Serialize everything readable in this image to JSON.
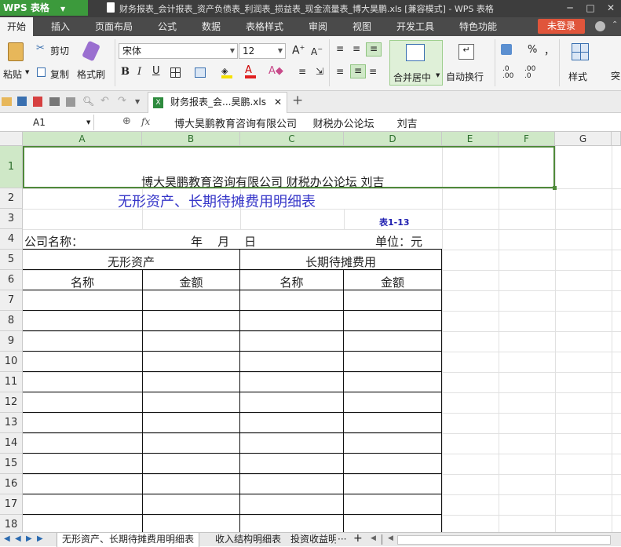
{
  "app": {
    "badge": "WPS 表格",
    "window_title": "财务报表_会计报表_资产负债表_利润表_损益表_现金流量表_博大昊鹏.xls [兼容模式] - WPS 表格"
  },
  "menu": {
    "tabs": [
      "开始",
      "插入",
      "页面布局",
      "公式",
      "数据",
      "表格样式",
      "审阅",
      "视图",
      "开发工具",
      "特色功能"
    ],
    "login": "未登录"
  },
  "ribbon": {
    "paste": "粘贴",
    "cut": "剪切",
    "copy": "复制",
    "format_painter": "格式刷",
    "font_name": "宋体",
    "font_size": "12",
    "merge_center": "合并居中",
    "wrap_text": "自动换行",
    "styles": "样式",
    "percent": "%",
    "comma": "，",
    "more": "突"
  },
  "quickbar": {
    "doc_tab": "财务报表_会...昊鹏.xls"
  },
  "formula": {
    "name_box": "A1",
    "fx": "fx",
    "content": "博大昊鹏教育咨询有限公司     财税办公论坛       刘吉"
  },
  "grid": {
    "columns": [
      "A",
      "B",
      "C",
      "D",
      "E",
      "F",
      "G"
    ],
    "rows": [
      "1",
      "2",
      "3",
      "4",
      "5",
      "6",
      "7",
      "8",
      "9",
      "10",
      "11",
      "12",
      "13",
      "14",
      "15",
      "16",
      "17",
      "18"
    ],
    "cells": {
      "a1": "博大昊鹏教育咨询有限公司     财税办公论坛       刘吉",
      "title": "无形资产、长期待摊费用明细表",
      "table_no": "表1-13",
      "company_label": "公司名称：",
      "date_label": "年    月    日",
      "unit_label": "单位：元",
      "header_intangible": "无形资产",
      "header_deferred": "长期待摊费用",
      "name1": "名称",
      "amount1": "金额",
      "name2": "名称",
      "amount2": "金额"
    }
  },
  "sheets": {
    "tabs": [
      "无形资产、长期待摊费用明细表",
      "收入结构明细表",
      "投资收益明"
    ],
    "more": "···",
    "add": "+"
  },
  "colors": {
    "accent_green": "#3c9a3c",
    "title_blue": "#3535c8",
    "login_red": "#e0553b"
  }
}
